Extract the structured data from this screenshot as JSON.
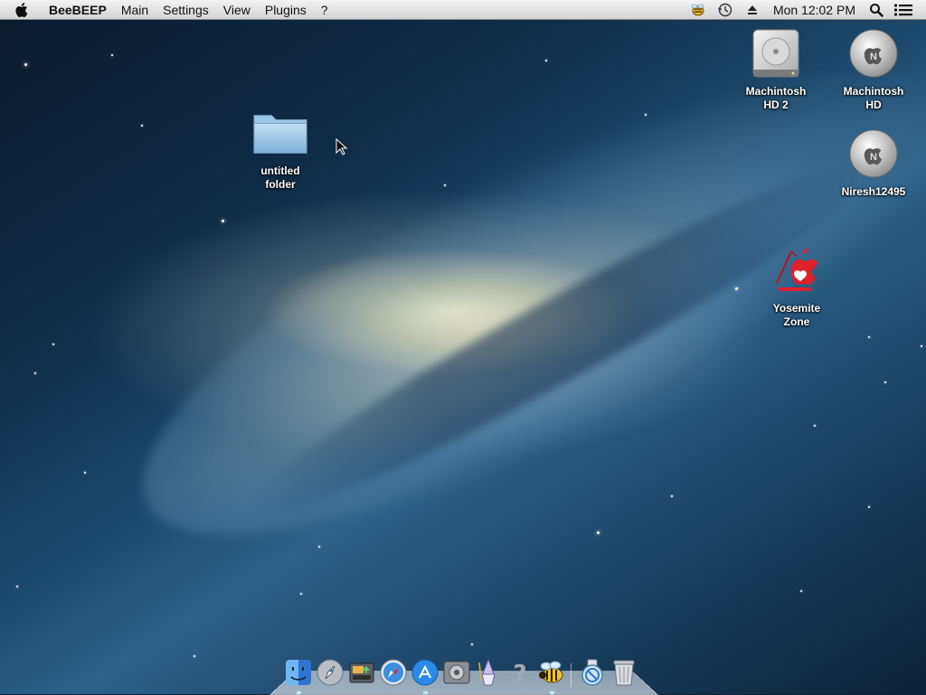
{
  "menubar": {
    "app_name": "BeeBEEP",
    "menus": [
      "Main",
      "Settings",
      "View",
      "Plugins",
      "?"
    ],
    "clock": "Mon 12:02 PM",
    "tray_icons": [
      "beebeep-tray-icon",
      "time-machine-icon",
      "eject-icon",
      "spotlight-icon",
      "notification-center-icon"
    ]
  },
  "desktop": {
    "icons": [
      {
        "label_1": "untitled",
        "label_2": "folder",
        "icon": "folder-icon"
      },
      {
        "label_1": "Machintosh",
        "label_2": "HD 2",
        "icon": "hard-drive-icon"
      },
      {
        "label_1": "Machintosh",
        "label_2": "HD",
        "icon": "niresh-disk-icon"
      },
      {
        "label_1": "Niresh12495",
        "label_2": "",
        "icon": "niresh-disk-icon"
      },
      {
        "label_1": "Yosemite",
        "label_2": "Zone",
        "icon": "yosemite-zone-icon"
      }
    ]
  },
  "dock": {
    "items": [
      "finder-icon",
      "launchpad-icon",
      "image-capture-icon",
      "safari-icon",
      "app-store-icon",
      "system-preferences-icon",
      "wizard-icon",
      "help-icon",
      "beebeep-icon",
      "dock-separator",
      "downloads-stack-icon",
      "trash-icon"
    ]
  },
  "colors": {
    "menubar": "#e4e4e4",
    "label_text": "#ffffff",
    "yosemite_red": "#e0202a"
  }
}
